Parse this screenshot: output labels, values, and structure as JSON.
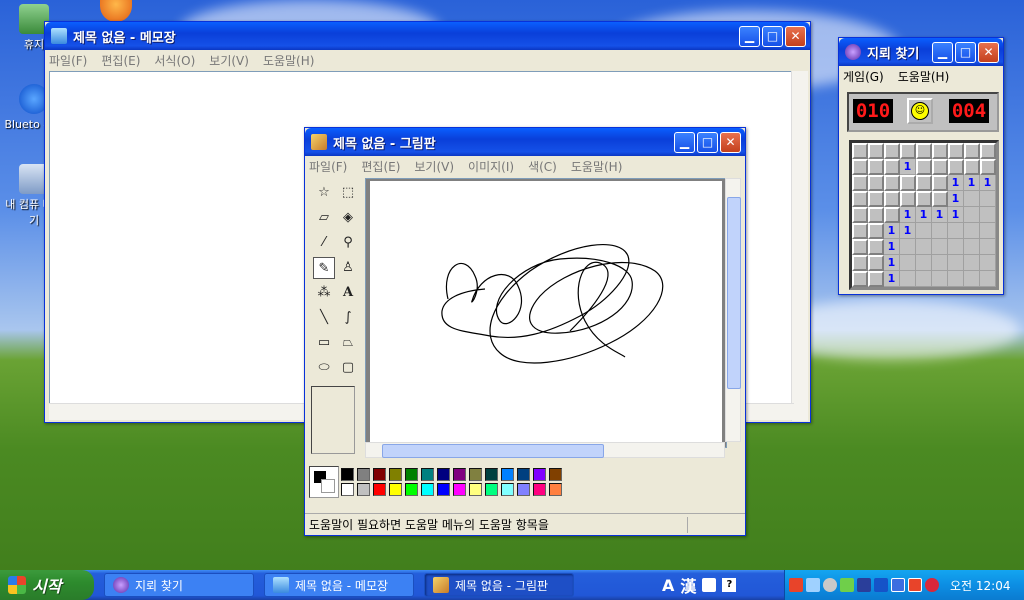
{
  "desktop": {
    "icons": [
      {
        "label": "휴지"
      },
      {
        "label": "Blueto 환경"
      },
      {
        "label": "내 컴퓨 바로 기"
      }
    ]
  },
  "notepad": {
    "title": "제목 없음 - 메모장",
    "menu": [
      "파일(F)",
      "편집(E)",
      "서식(O)",
      "보기(V)",
      "도움말(H)"
    ]
  },
  "minesweeper": {
    "title": "지뢰 찾기",
    "menu": [
      "게임(G)",
      "도움말(H)"
    ],
    "mine_counter": "010",
    "timer": "004",
    "face": "☺",
    "grid": [
      "#########",
      "###1#####",
      "######111",
      "######1  ",
      "###1111  ",
      "##11     ",
      "##1      ",
      "##1      ",
      "##1      "
    ]
  },
  "paint": {
    "title": "제목 없음 - 그림판",
    "menu": [
      "파일(F)",
      "편집(E)",
      "보기(V)",
      "이미지(I)",
      "색(C)",
      "도움말(H)"
    ],
    "status": "도움말이 필요하면 도움말 메뉴의 도움말 항목을",
    "palette_top": [
      "#000000",
      "#808080",
      "#800000",
      "#808000",
      "#008000",
      "#008080",
      "#000080",
      "#800080",
      "#808040",
      "#004040",
      "#0080ff",
      "#004080",
      "#8000ff",
      "#804000"
    ],
    "palette_bottom": [
      "#ffffff",
      "#c0c0c0",
      "#ff0000",
      "#ffff00",
      "#00ff00",
      "#00ffff",
      "#0000ff",
      "#ff00ff",
      "#ffff80",
      "#00ff80",
      "#80ffff",
      "#8080ff",
      "#ff0080",
      "#ff8040"
    ]
  },
  "taskbar": {
    "start_label": "시작",
    "tasks": [
      {
        "label": "지뢰 찾기"
      },
      {
        "label": "제목 없음 - 메모장"
      },
      {
        "label": "제목 없음 - 그림판"
      }
    ],
    "ime": {
      "a": "A",
      "han": "漢"
    },
    "clock": "오전 12:04"
  }
}
